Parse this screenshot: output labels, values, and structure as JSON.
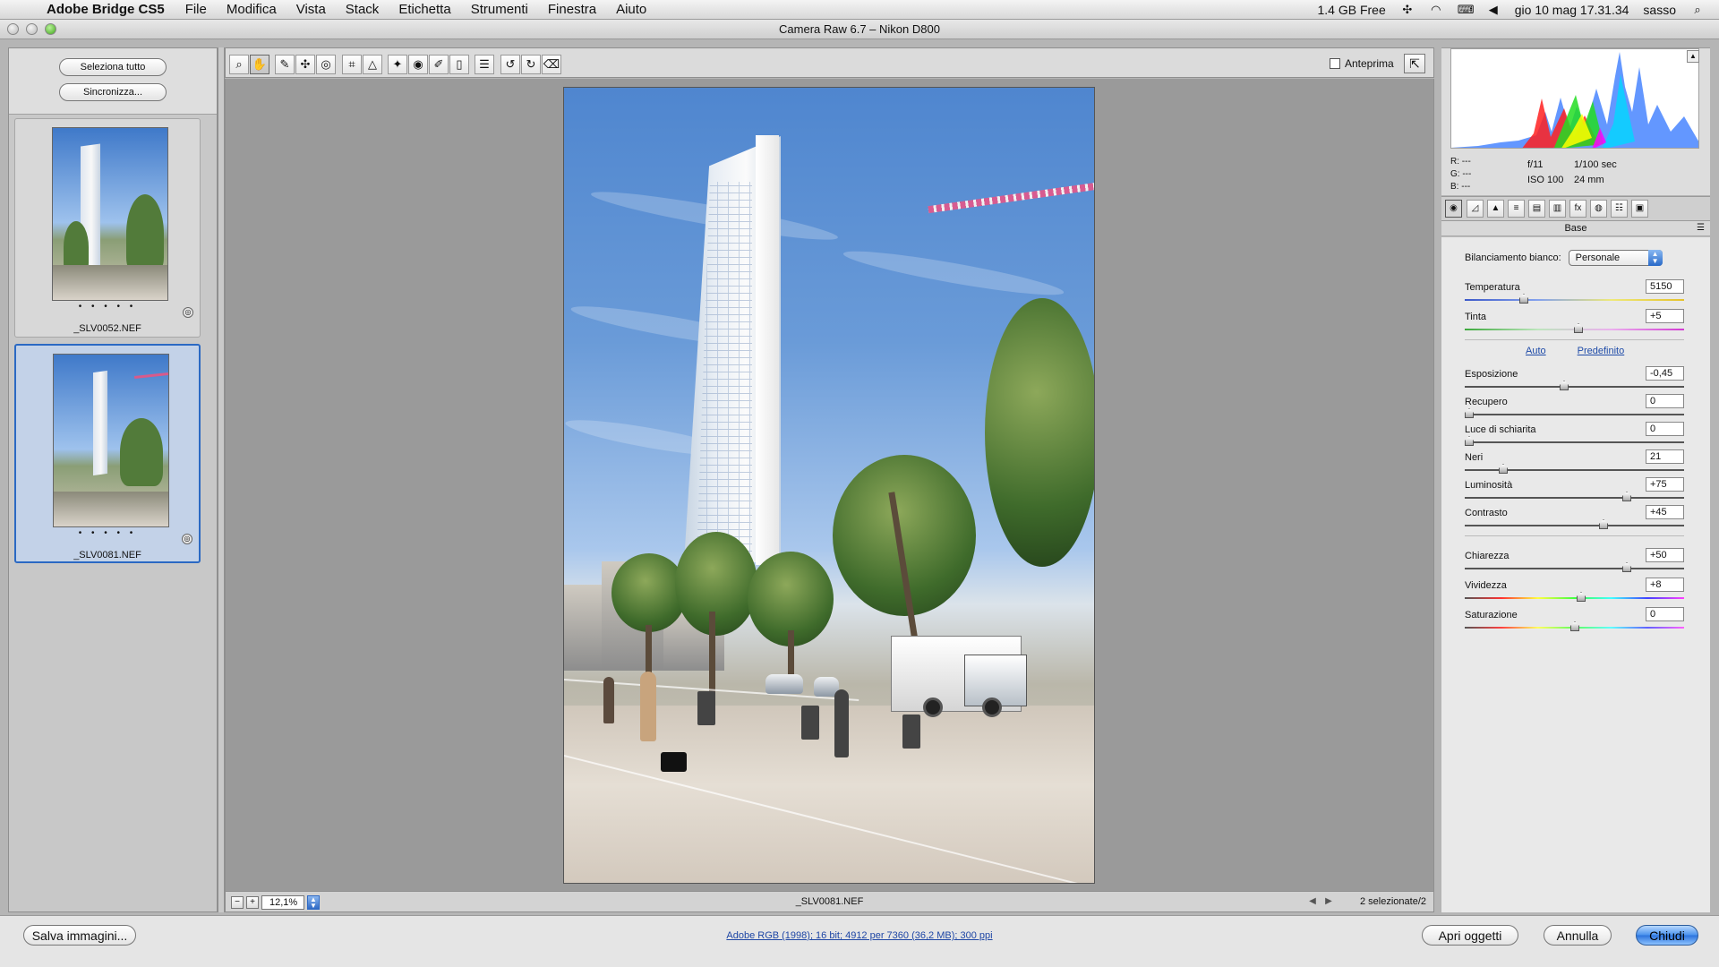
{
  "menubar": {
    "app_name": "Adobe Bridge CS5",
    "items": [
      "File",
      "Modifica",
      "Vista",
      "Stack",
      "Etichetta",
      "Strumenti",
      "Finestra",
      "Aiuto"
    ],
    "memory": "1.4 GB Free",
    "datetime": "gio 10 mag 17.31.34",
    "user": "sasso"
  },
  "window": {
    "title": "Camera Raw 6.7  –  Nikon D800"
  },
  "filmstrip": {
    "select_all": "Seleziona tutto",
    "synchronize": "Sincronizza...",
    "items": [
      {
        "name": "_SLV0052.NEF",
        "rating": "• • • • •"
      },
      {
        "name": "_SLV0081.NEF",
        "rating": "• • • • •"
      }
    ]
  },
  "toolbar": {
    "preview_label": "Anteprima",
    "tools": [
      "zoom-tool-icon",
      "hand-tool-icon",
      "white-balance-tool-icon",
      "color-sampler-tool-icon",
      "targeted-adjustment-tool-icon",
      "crop-tool-icon",
      "straighten-tool-icon",
      "spot-removal-tool-icon",
      "red-eye-tool-icon",
      "adjustment-brush-icon",
      "graduated-filter-icon",
      "preferences-icon",
      "rotate-left-icon",
      "rotate-right-icon",
      "trash-icon"
    ]
  },
  "preview": {
    "zoom": "12,1%",
    "filename": "_SLV0081.NEF",
    "selection": "2 selezionate/2"
  },
  "histogram": {
    "r": "---",
    "g": "---",
    "b": "---",
    "aperture": "f/11",
    "shutter": "1/100 sec",
    "iso": "ISO 100",
    "focal_length": "24 mm"
  },
  "basic_panel": {
    "title": "Base",
    "white_balance_label": "Bilanciamento bianco:",
    "white_balance_value": "Personale",
    "auto_link": "Auto",
    "default_link": "Predefinito",
    "sliders": [
      {
        "label": "Temperatura",
        "value": "5150",
        "position": 0.26
      },
      {
        "label": "Tinta",
        "value": "+5",
        "position": 0.52
      },
      {
        "label": "Esposizione",
        "value": "-0,45",
        "position": 0.45
      },
      {
        "label": "Recupero",
        "value": "0",
        "position": 0.0
      },
      {
        "label": "Luce di schiarita",
        "value": "0",
        "position": 0.0
      },
      {
        "label": "Neri",
        "value": "21",
        "position": 0.16
      },
      {
        "label": "Luminosità",
        "value": "+75",
        "position": 0.75
      },
      {
        "label": "Contrasto",
        "value": "+45",
        "position": 0.64
      },
      {
        "label": "Chiarezza",
        "value": "+50",
        "position": 0.75
      },
      {
        "label": "Vividezza",
        "value": "+8",
        "position": 0.53
      },
      {
        "label": "Saturazione",
        "value": "0",
        "position": 0.5
      }
    ]
  },
  "bottom_bar": {
    "save_images": "Salva immagini...",
    "workflow": "Adobe RGB (1998); 16 bit; 4912 per 7360 (36,2 MB); 300 ppi",
    "open_objects": "Apri oggetti",
    "cancel": "Annulla",
    "close": "Chiudi"
  },
  "main_image": {
    "description": "Street scene with tall white tower, trees, pedestrians and delivery truck"
  }
}
